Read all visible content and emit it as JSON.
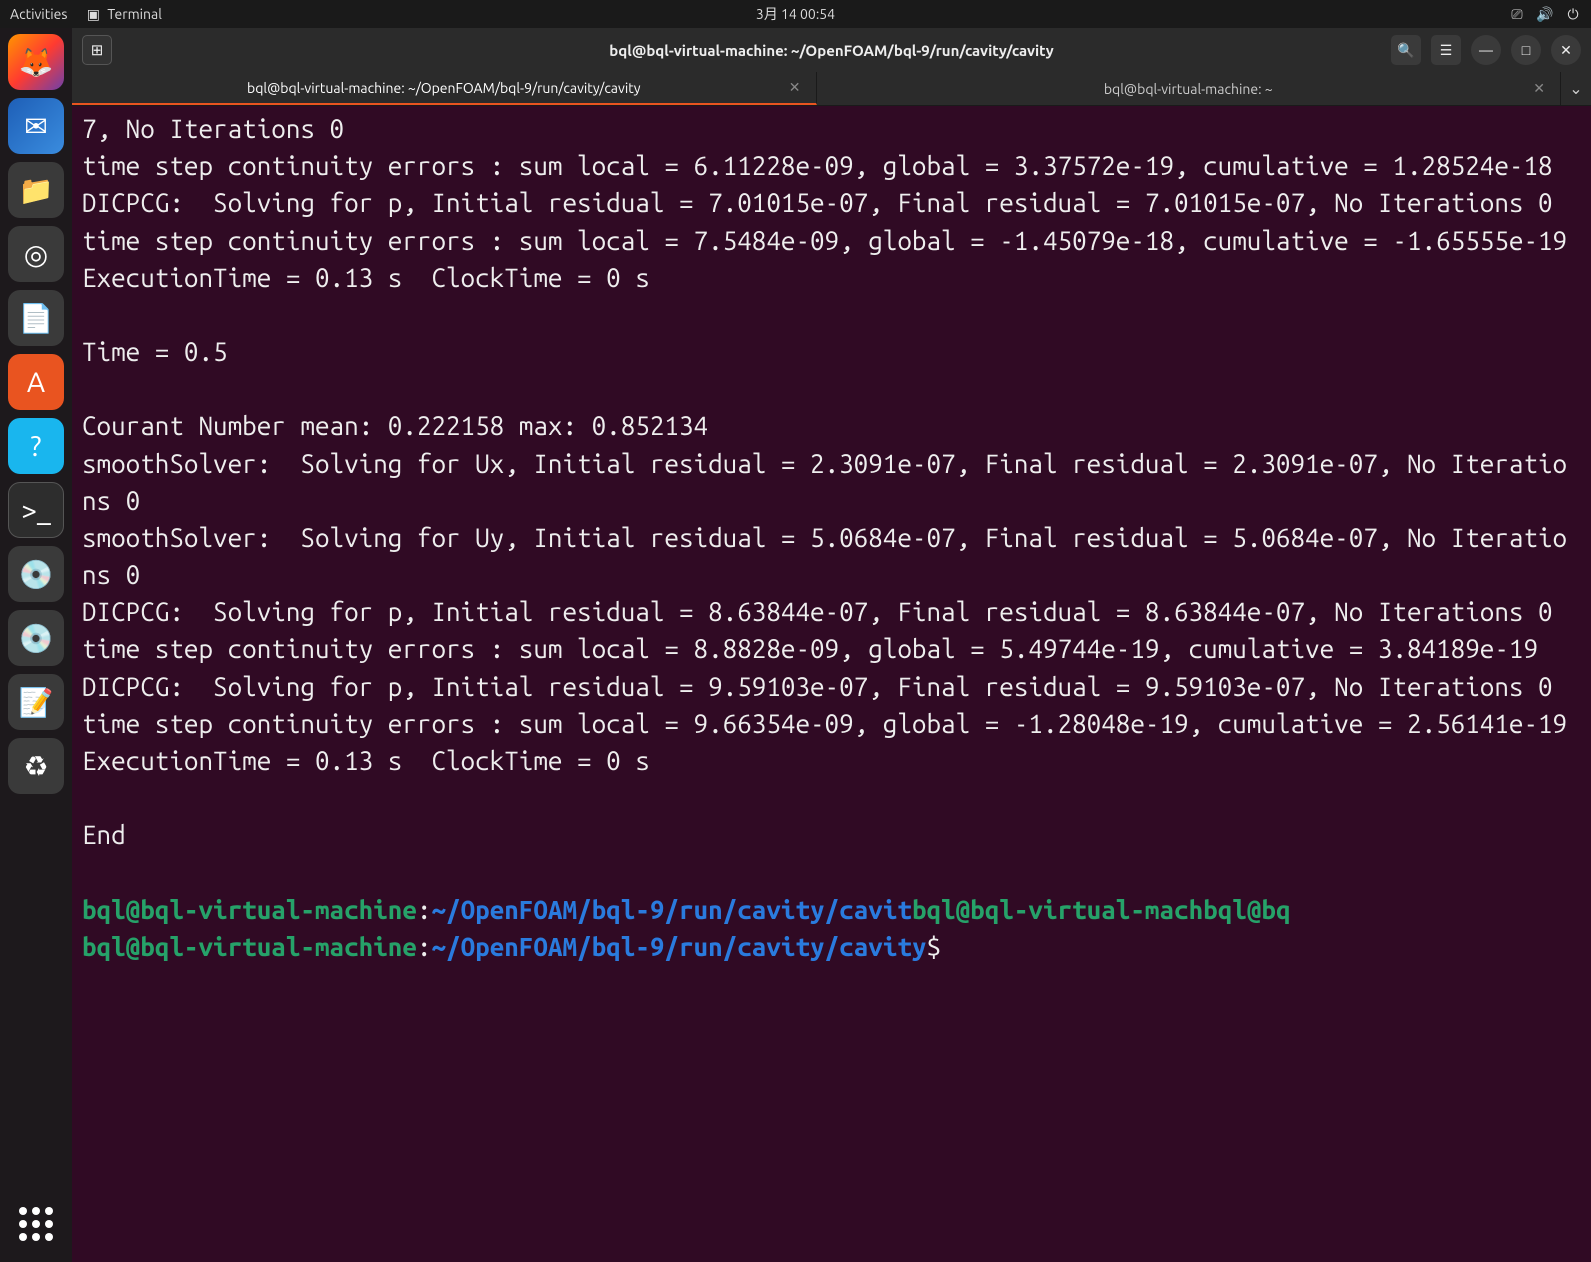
{
  "topbar": {
    "activities": "Activities",
    "app": "Terminal",
    "datetime": "3月 14 00:54"
  },
  "window": {
    "title": "bql@bql-virtual-machine: ~/OpenFOAM/bql-9/run/cavity/cavity"
  },
  "tabs": {
    "t1": "bql@bql-virtual-machine: ~/OpenFOAM/bql-9/run/cavity/cavity",
    "t2": "bql@bql-virtual-machine: ~"
  },
  "output": {
    "l1": "7, No Iterations 0",
    "l2": "time step continuity errors : sum local = 6.11228e-09, global = 3.37572e-19, cumulative = 1.28524e-18",
    "l3": "DICPCG:  Solving for p, Initial residual = 7.01015e-07, Final residual = 7.01015e-07, No Iterations 0",
    "l4": "time step continuity errors : sum local = 7.5484e-09, global = -1.45079e-18, cumulative = -1.65555e-19",
    "l5": "ExecutionTime = 0.13 s  ClockTime = 0 s",
    "l6": "",
    "l7": "Time = 0.5",
    "l8": "",
    "l9": "Courant Number mean: 0.222158 max: 0.852134",
    "l10": "smoothSolver:  Solving for Ux, Initial residual = 2.3091e-07, Final residual = 2.3091e-07, No Iterations 0",
    "l11": "smoothSolver:  Solving for Uy, Initial residual = 5.0684e-07, Final residual = 5.0684e-07, No Iterations 0",
    "l12": "DICPCG:  Solving for p, Initial residual = 8.63844e-07, Final residual = 8.63844e-07, No Iterations 0",
    "l13": "time step continuity errors : sum local = 8.8828e-09, global = 5.49744e-19, cumulative = 3.84189e-19",
    "l14": "DICPCG:  Solving for p, Initial residual = 9.59103e-07, Final residual = 9.59103e-07, No Iterations 0",
    "l15": "time step continuity errors : sum local = 9.66354e-09, global = -1.28048e-19, cumulative = 2.56141e-19",
    "l16": "ExecutionTime = 0.13 s  ClockTime = 0 s",
    "l17": "",
    "l18": "End",
    "l19": ""
  },
  "prompt": {
    "user": "bql@bql-virtual-machine",
    "colon": ":",
    "path": "~/OpenFOAM/bql-9/run/cavity/cavit",
    "extra1": "bql@bql-virtual-mach",
    "extra2": "bql@bq",
    "path2": "~/OpenFOAM/bql-9/run/cavity/cavity",
    "dollar": "$"
  }
}
